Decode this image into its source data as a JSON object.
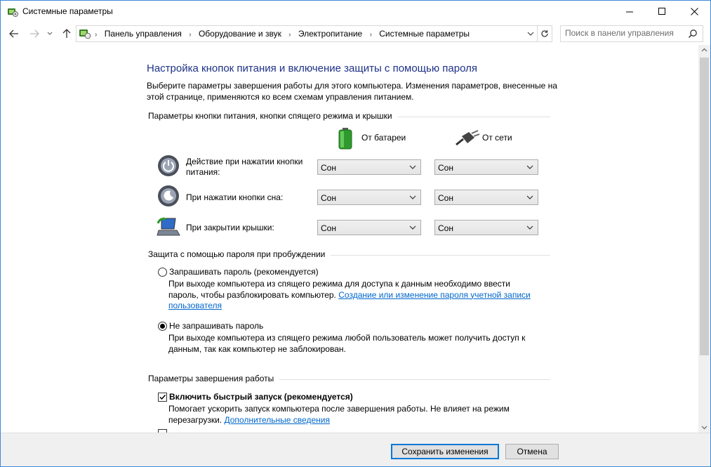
{
  "window": {
    "title": "Системные параметры",
    "minimize_glyph": "—",
    "maximize_glyph": "☐",
    "close_glyph": "✕"
  },
  "nav": {
    "breadcrumbs": [
      "Панель управления",
      "Оборудование и звук",
      "Электропитание",
      "Системные параметры"
    ],
    "search_placeholder": "Поиск в панели управления"
  },
  "main": {
    "heading": "Настройка кнопок питания и включение защиты с помощью пароля",
    "intro_line1": "Выберите параметры завершения работы для этого компьютера. Изменения параметров, внесенные на",
    "intro_line2": "этой странице, применяются ко всем схемам управления питанием.",
    "power_section": {
      "title": "Параметры кнопки питания, кнопки спящего режима и крышки",
      "col_battery": "От батареи",
      "col_plugged": "От сети",
      "rows": [
        {
          "label_line1": "Действие при нажатии кнопки",
          "label_line2": "питания:",
          "battery": "Сон",
          "plugged": "Сон"
        },
        {
          "label_line1": "При нажатии кнопки сна:",
          "label_line2": "",
          "battery": "Сон",
          "plugged": "Сон"
        },
        {
          "label_line1": "При закрытии крышки:",
          "label_line2": "",
          "battery": "Сон",
          "plugged": "Сон"
        }
      ]
    },
    "password_section": {
      "title": "Защита с помощью пароля при пробуждении",
      "opt1_label": "Запрашивать пароль (рекомендуется)",
      "opt1_desc_line1": "При выходе компьютера из спящего режима для доступа к данным необходимо ввести",
      "opt1_desc_line2": "пароль, чтобы разблокировать компьютер.",
      "opt1_link_part1": "Создание или изменение пароля учетной записи",
      "opt1_link_part2": "пользователя",
      "opt2_label": "Не запрашивать пароль",
      "opt2_desc_line1": "При выходе компьютера из спящего режима любой пользователь может получить доступ к",
      "opt2_desc_line2": "данным, так как компьютер не заблокирован.",
      "selected": "opt2"
    },
    "shutdown_section": {
      "title": "Параметры завершения работы",
      "fast_startup_label": "Включить быстрый запуск (рекомендуется)",
      "fast_startup_checked": true,
      "fast_startup_desc_line1": "Помогает ускорить запуск компьютера после завершения работы. Не влияет на режим",
      "fast_startup_desc_line2": "перезагрузки.",
      "more_info_link": "Дополнительные сведения"
    }
  },
  "footer": {
    "save_label": "Сохранить изменения",
    "cancel_label": "Отмена"
  },
  "colors": {
    "heading": "#1e3287",
    "link": "#0066cc",
    "window_border": "#3c8ad6",
    "primary_button_border": "#0078d7"
  }
}
